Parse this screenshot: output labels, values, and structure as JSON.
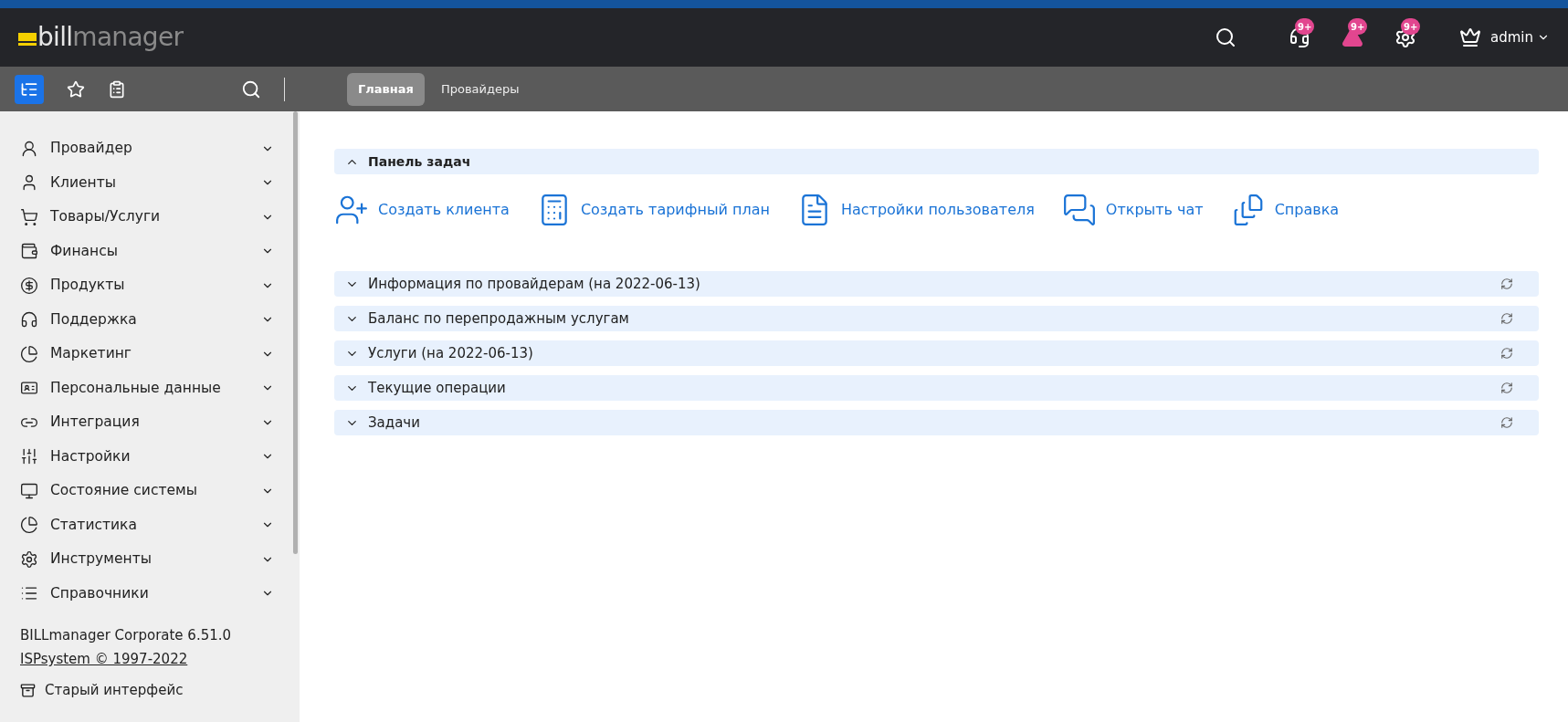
{
  "header": {
    "logo": {
      "part_1": "bill",
      "part_2": "manager"
    },
    "badges": [
      "9+",
      "9+",
      "9+"
    ],
    "user": "admin"
  },
  "toolbar": {
    "tabs": [
      {
        "label": "Главная",
        "selected": true
      },
      {
        "label": "Провайдеры",
        "selected": false
      }
    ]
  },
  "sidebar": {
    "items": [
      {
        "label": "Провайдер",
        "expanded": false
      },
      {
        "label": "Клиенты",
        "expanded": false
      },
      {
        "label": "Товары/Услуги",
        "expanded": false
      },
      {
        "label": "Финансы",
        "expanded": false
      },
      {
        "label": "Продукты",
        "expanded": false
      },
      {
        "label": "Поддержка",
        "expanded": false
      },
      {
        "label": "Маркетинг",
        "expanded": false
      },
      {
        "label": "Персональные данные",
        "expanded": false
      },
      {
        "label": "Интеграция",
        "expanded": false
      },
      {
        "label": "Настройки",
        "expanded": false
      },
      {
        "label": "Состояние системы",
        "expanded": false
      },
      {
        "label": "Статистика",
        "expanded": false
      },
      {
        "label": "Инструменты",
        "expanded": false
      },
      {
        "label": "Справочники",
        "expanded": false
      }
    ],
    "version": "BILLmanager Corporate 6.51.0",
    "copyright": "ISPsystem © 1997-2022",
    "old_interface": "Старый интерфейс"
  },
  "task_panel": {
    "title": "Панель задач",
    "expanded": true,
    "actions": [
      "Создать клиента",
      "Создать тарифный план",
      "Настройки пользователя",
      "Открыть чат",
      "Справка"
    ]
  },
  "sections": [
    {
      "title": "Информация по провайдерам (на 2022-06-13)",
      "expanded": false
    },
    {
      "title": "Баланс по перепродажным услугам",
      "expanded": false
    },
    {
      "title": "Услуги (на 2022-06-13)",
      "expanded": false
    },
    {
      "title": "Текущие операции",
      "expanded": false
    },
    {
      "title": "Задачи",
      "expanded": false
    }
  ]
}
